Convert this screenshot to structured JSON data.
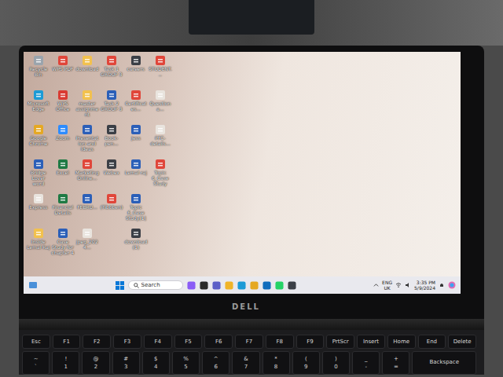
{
  "desktop": {
    "columns": [
      [
        {
          "label": "Recycle Bin",
          "kind": "recycle"
        },
        {
          "label": "Microsoft Edge",
          "kind": "edge"
        },
        {
          "label": "Google Chrome",
          "kind": "chrome"
        },
        {
          "label": "Bridge Lover word",
          "kind": "word"
        },
        {
          "label": "Express",
          "kind": "image"
        },
        {
          "label": "Inside Lemal Raj",
          "kind": "folder"
        }
      ],
      [
        {
          "label": "WPS PDF",
          "kind": "pdf"
        },
        {
          "label": "WPS Office",
          "kind": "wps"
        },
        {
          "label": "Zoom",
          "kind": "zoom"
        },
        {
          "label": "Excel",
          "kind": "excel"
        },
        {
          "label": "Financial Details",
          "kind": "excel"
        },
        {
          "label": "Case Study for chapter 4",
          "kind": "word"
        }
      ],
      [
        {
          "label": "download",
          "kind": "folder"
        },
        {
          "label": "master assignment",
          "kind": "folder"
        },
        {
          "label": "Presentation and Ideas",
          "kind": "word"
        },
        {
          "label": "Marketing Online...",
          "kind": "pdf"
        },
        {
          "label": "FEBRU...",
          "kind": "word"
        },
        {
          "label": "jpeg_2024...",
          "kind": "image"
        }
      ],
      [
        {
          "label": "Task 1 GROUP 3",
          "kind": "pdf"
        },
        {
          "label": "Task 2 GROUP 3",
          "kind": "word"
        },
        {
          "label": "Book-pen...",
          "kind": "app"
        },
        {
          "label": "Webex",
          "kind": "app"
        },
        {
          "label": "(Tibbben)",
          "kind": "pdf"
        }
      ],
      [
        {
          "label": "careers",
          "kind": "app"
        },
        {
          "label": "Certificates...",
          "kind": "pdf"
        },
        {
          "label": "Jess",
          "kind": "word"
        },
        {
          "label": "Lemal raj",
          "kind": "word"
        },
        {
          "label": "Topic 6_Case Study[1]",
          "kind": "word"
        },
        {
          "label": "download (1)",
          "kind": "app"
        }
      ],
      [
        {
          "label": "STUDENT...",
          "kind": "pdf"
        },
        {
          "label": "Question a...",
          "kind": "image"
        },
        {
          "label": "PFC-details...",
          "kind": "image"
        },
        {
          "label": "Topic 6_Case Study",
          "kind": "pdf"
        }
      ]
    ]
  },
  "taskbar": {
    "search": {
      "placeholder": "Search"
    },
    "apps": [
      {
        "kind": "copilot"
      },
      {
        "kind": "taskview"
      },
      {
        "kind": "teams"
      },
      {
        "kind": "explorer"
      },
      {
        "kind": "edge"
      },
      {
        "kind": "chrome"
      },
      {
        "kind": "mail"
      },
      {
        "kind": "whatsapp"
      },
      {
        "kind": "app"
      }
    ],
    "tray": {
      "language": "ENG",
      "region": "UK",
      "time": "3:35 PM",
      "date": "5/9/2024"
    }
  },
  "brand": "DELL",
  "keyboard": {
    "function_row": [
      "Esc",
      "F1",
      "F2",
      "F3",
      "F4",
      "F5",
      "F6",
      "F7",
      "F8",
      "F9",
      "PrtScr",
      "Insert",
      "Home",
      "End",
      "Delete"
    ],
    "number_row": [
      {
        "top": "~",
        "bottom": "`"
      },
      {
        "top": "!",
        "bottom": "1"
      },
      {
        "top": "@",
        "bottom": "2"
      },
      {
        "top": "#",
        "bottom": "3"
      },
      {
        "top": "$",
        "bottom": "4"
      },
      {
        "top": "%",
        "bottom": "5"
      },
      {
        "top": "^",
        "bottom": "6"
      },
      {
        "top": "&",
        "bottom": "7"
      },
      {
        "top": "*",
        "bottom": "8"
      },
      {
        "top": "(",
        "bottom": "9"
      },
      {
        "top": ")",
        "bottom": "0"
      },
      {
        "top": "_",
        "bottom": "-"
      },
      {
        "top": "+",
        "bottom": "="
      },
      {
        "top": "Backspace",
        "bottom": ""
      }
    ]
  }
}
